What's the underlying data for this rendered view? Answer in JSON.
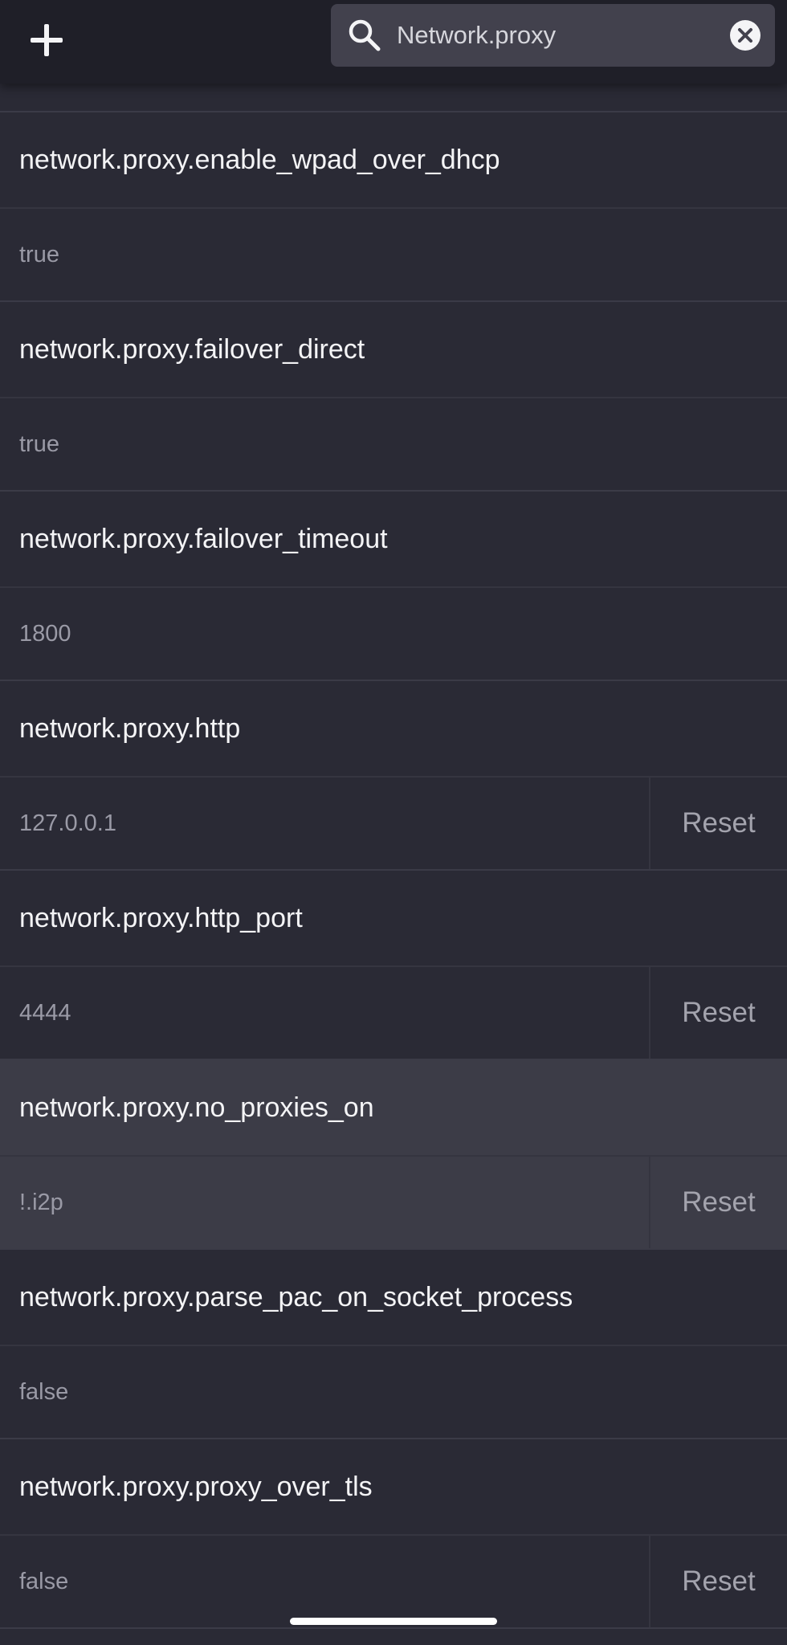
{
  "toolbar": {
    "add_icon": "plus-icon",
    "search_icon": "search-icon",
    "clear_icon": "clear-circle-x-icon",
    "search_value": "Network.proxy"
  },
  "prefs": [
    {
      "name": "network.proxy.enable_wpad_over_dhcp",
      "value": "true",
      "reset": ""
    },
    {
      "name": "network.proxy.failover_direct",
      "value": "true",
      "reset": ""
    },
    {
      "name": "network.proxy.failover_timeout",
      "value": "1800",
      "reset": ""
    },
    {
      "name": "network.proxy.http",
      "value": "127.0.0.1",
      "reset": "Reset"
    },
    {
      "name": "network.proxy.http_port",
      "value": "4444",
      "reset": "Reset"
    },
    {
      "name": "network.proxy.no_proxies_on",
      "value": "!.i2p",
      "reset": "Reset",
      "selected": true
    },
    {
      "name": "network.proxy.parse_pac_on_socket_process",
      "value": "false",
      "reset": ""
    },
    {
      "name": "network.proxy.proxy_over_tls",
      "value": "false",
      "reset": "Reset"
    }
  ],
  "colors": {
    "background": "#2a2a35",
    "topbar": "#1f1f28",
    "search_field": "#42414d",
    "selected_row": "#3c3c47",
    "text_primary": "#f4f4f6",
    "text_secondary": "#9a9aa6"
  }
}
